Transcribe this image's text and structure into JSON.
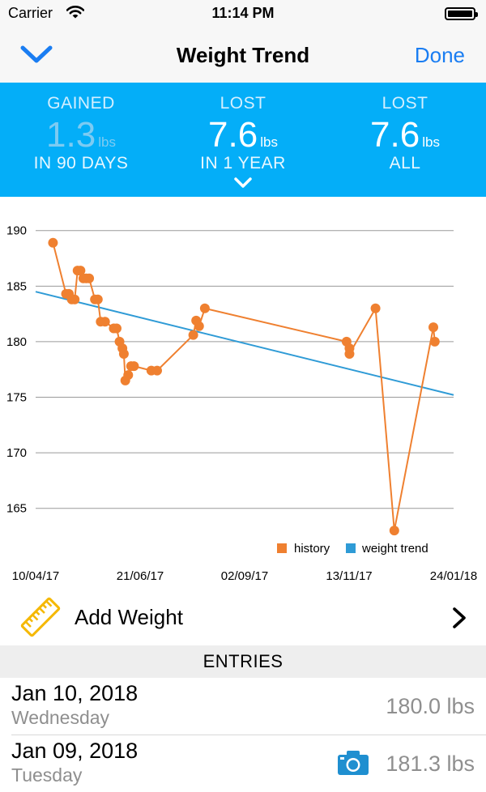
{
  "status_bar": {
    "carrier": "Carrier",
    "time": "11:14 PM"
  },
  "nav": {
    "title": "Weight Trend",
    "done_label": "Done",
    "back_icon": "chevron-down-icon"
  },
  "stats": [
    {
      "label": "GAINED",
      "value": "1.3",
      "unit": "lbs",
      "period": "IN 90 DAYS"
    },
    {
      "label": "LOST",
      "value": "7.6",
      "unit": "lbs",
      "period": "IN 1 YEAR"
    },
    {
      "label": "LOST",
      "value": "7.6",
      "unit": "lbs",
      "period": "ALL"
    }
  ],
  "colors": {
    "accent": "#04aef8",
    "history": "#ef8030",
    "trend": "#2f9bd6",
    "link": "#1a7df2"
  },
  "chart_data": {
    "type": "line",
    "x_tick_labels": [
      "10/04/17",
      "21/06/17",
      "02/09/17",
      "13/11/17",
      "24/01/18"
    ],
    "y_ticks": [
      190,
      185,
      180,
      175,
      170,
      165
    ],
    "ylim": [
      162.5,
      191
    ],
    "xlim": [
      "2017-04-10",
      "2018-01-24"
    ],
    "grid": true,
    "legend_position": "bottom-right",
    "series": [
      {
        "name": "history",
        "color": "#ef8030",
        "points": [
          [
            "2017-04-22",
            188.9
          ],
          [
            "2017-05-01",
            184.3
          ],
          [
            "2017-05-03",
            184.3
          ],
          [
            "2017-05-05",
            183.8
          ],
          [
            "2017-05-07",
            183.8
          ],
          [
            "2017-05-09",
            186.4
          ],
          [
            "2017-05-11",
            186.4
          ],
          [
            "2017-05-13",
            185.7
          ],
          [
            "2017-05-15",
            185.7
          ],
          [
            "2017-05-17",
            185.7
          ],
          [
            "2017-05-21",
            183.8
          ],
          [
            "2017-05-23",
            183.8
          ],
          [
            "2017-05-25",
            181.8
          ],
          [
            "2017-05-28",
            181.8
          ],
          [
            "2017-06-03",
            181.2
          ],
          [
            "2017-06-05",
            181.2
          ],
          [
            "2017-06-07",
            180.0
          ],
          [
            "2017-06-09",
            179.4
          ],
          [
            "2017-06-10",
            178.9
          ],
          [
            "2017-06-11",
            176.5
          ],
          [
            "2017-06-13",
            177.0
          ],
          [
            "2017-06-15",
            177.8
          ],
          [
            "2017-06-17",
            177.8
          ],
          [
            "2017-06-29",
            177.4
          ],
          [
            "2017-07-03",
            177.4
          ],
          [
            "2017-07-28",
            180.6
          ],
          [
            "2017-07-30",
            181.9
          ],
          [
            "2017-08-01",
            181.4
          ],
          [
            "2017-08-05",
            183.0
          ],
          [
            "2017-11-11",
            180.0
          ],
          [
            "2017-11-13",
            179.4
          ],
          [
            "2017-11-13",
            178.9
          ],
          [
            "2017-12-01",
            183.0
          ],
          [
            "2017-12-14",
            163.0
          ],
          [
            "2018-01-10",
            181.3
          ],
          [
            "2018-01-11",
            180.0
          ]
        ]
      },
      {
        "name": "weight trend",
        "color": "#2f9bd6",
        "points": [
          [
            "2017-04-10",
            184.5
          ],
          [
            "2018-01-24",
            175.2
          ]
        ]
      }
    ]
  },
  "add_weight": {
    "label": "Add Weight"
  },
  "section": {
    "title": "ENTRIES"
  },
  "entries": [
    {
      "date": "Jan 10, 2018",
      "day": "Wednesday",
      "weight": "180.0 lbs",
      "has_photo": false
    },
    {
      "date": "Jan 09, 2018",
      "day": "Tuesday",
      "weight": "181.3 lbs",
      "has_photo": true
    }
  ]
}
